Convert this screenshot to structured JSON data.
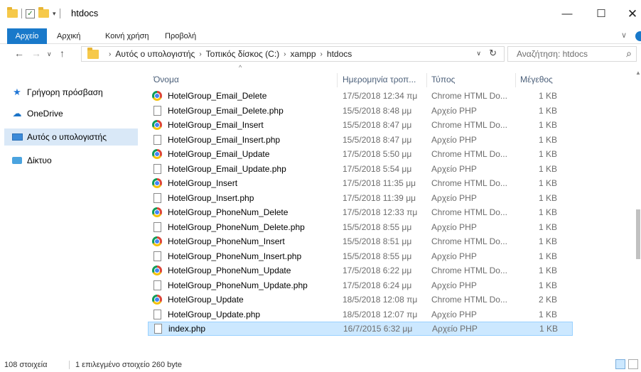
{
  "window": {
    "title": "htdocs",
    "min_glyph": "—",
    "max_glyph": "☐",
    "close_glyph": "✕"
  },
  "ribbon": {
    "tabs": [
      "Αρχείο",
      "Αρχική",
      "Κοινή χρήση",
      "Προβολή"
    ]
  },
  "address": {
    "crumbs": [
      "Αυτός ο υπολογιστής",
      "Τοπικός δίσκος (C:)",
      "xampp",
      "htdocs"
    ],
    "search_placeholder": "Αναζήτηση: htdocs"
  },
  "nav_pane": {
    "items": [
      {
        "label": "Γρήγορη πρόσβαση",
        "icon": "star-icon"
      },
      {
        "label": "OneDrive",
        "icon": "cloud-icon"
      },
      {
        "label": "Αυτός ο υπολογιστής",
        "icon": "computer-icon",
        "selected": true
      },
      {
        "label": "Δίκτυο",
        "icon": "network-icon"
      }
    ]
  },
  "columns": {
    "name": "Όνομα",
    "date": "Ημερομηνία τροπ...",
    "type": "Τύπος",
    "size": "Μέγεθος"
  },
  "files": [
    {
      "name": "HotelGroup_Email_Delete",
      "date": "17/5/2018 12:34 πμ",
      "type": "Chrome HTML Do...",
      "size": "1 KB",
      "icon": "chrome"
    },
    {
      "name": "HotelGroup_Email_Delete.php",
      "date": "15/5/2018 8:48 μμ",
      "type": "Αρχείο PHP",
      "size": "1 KB",
      "icon": "php"
    },
    {
      "name": "HotelGroup_Email_Insert",
      "date": "15/5/2018 8:47 μμ",
      "type": "Chrome HTML Do...",
      "size": "1 KB",
      "icon": "chrome"
    },
    {
      "name": "HotelGroup_Email_Insert.php",
      "date": "15/5/2018 8:47 μμ",
      "type": "Αρχείο PHP",
      "size": "1 KB",
      "icon": "php"
    },
    {
      "name": "HotelGroup_Email_Update",
      "date": "17/5/2018 5:50 μμ",
      "type": "Chrome HTML Do...",
      "size": "1 KB",
      "icon": "chrome"
    },
    {
      "name": "HotelGroup_Email_Update.php",
      "date": "17/5/2018 5:54 μμ",
      "type": "Αρχείο PHP",
      "size": "1 KB",
      "icon": "php"
    },
    {
      "name": "HotelGroup_Insert",
      "date": "17/5/2018 11:35 μμ",
      "type": "Chrome HTML Do...",
      "size": "1 KB",
      "icon": "chrome"
    },
    {
      "name": "HotelGroup_Insert.php",
      "date": "17/5/2018 11:39 μμ",
      "type": "Αρχείο PHP",
      "size": "1 KB",
      "icon": "php"
    },
    {
      "name": "HotelGroup_PhoneNum_Delete",
      "date": "17/5/2018 12:33 πμ",
      "type": "Chrome HTML Do...",
      "size": "1 KB",
      "icon": "chrome"
    },
    {
      "name": "HotelGroup_PhoneNum_Delete.php",
      "date": "15/5/2018 8:55 μμ",
      "type": "Αρχείο PHP",
      "size": "1 KB",
      "icon": "php"
    },
    {
      "name": "HotelGroup_PhoneNum_Insert",
      "date": "15/5/2018 8:51 μμ",
      "type": "Chrome HTML Do...",
      "size": "1 KB",
      "icon": "chrome"
    },
    {
      "name": "HotelGroup_PhoneNum_Insert.php",
      "date": "15/5/2018 8:55 μμ",
      "type": "Αρχείο PHP",
      "size": "1 KB",
      "icon": "php"
    },
    {
      "name": "HotelGroup_PhoneNum_Update",
      "date": "17/5/2018 6:22 μμ",
      "type": "Chrome HTML Do...",
      "size": "1 KB",
      "icon": "chrome"
    },
    {
      "name": "HotelGroup_PhoneNum_Update.php",
      "date": "17/5/2018 6:24 μμ",
      "type": "Αρχείο PHP",
      "size": "1 KB",
      "icon": "php"
    },
    {
      "name": "HotelGroup_Update",
      "date": "18/5/2018 12:08 πμ",
      "type": "Chrome HTML Do...",
      "size": "2 KB",
      "icon": "chrome"
    },
    {
      "name": "HotelGroup_Update.php",
      "date": "18/5/2018 12:07 πμ",
      "type": "Αρχείο PHP",
      "size": "1 KB",
      "icon": "php"
    },
    {
      "name": "index.php",
      "date": "16/7/2015 6:32 μμ",
      "type": "Αρχείο PHP",
      "size": "1 KB",
      "icon": "php",
      "selected": true
    }
  ],
  "status": {
    "count": "108 στοιχεία",
    "selection": "1 επιλεγμένο στοιχείο 260 byte"
  },
  "colors": {
    "accent": "#1979ca",
    "selection": "#cce8ff",
    "header_text": "#4c607a"
  }
}
